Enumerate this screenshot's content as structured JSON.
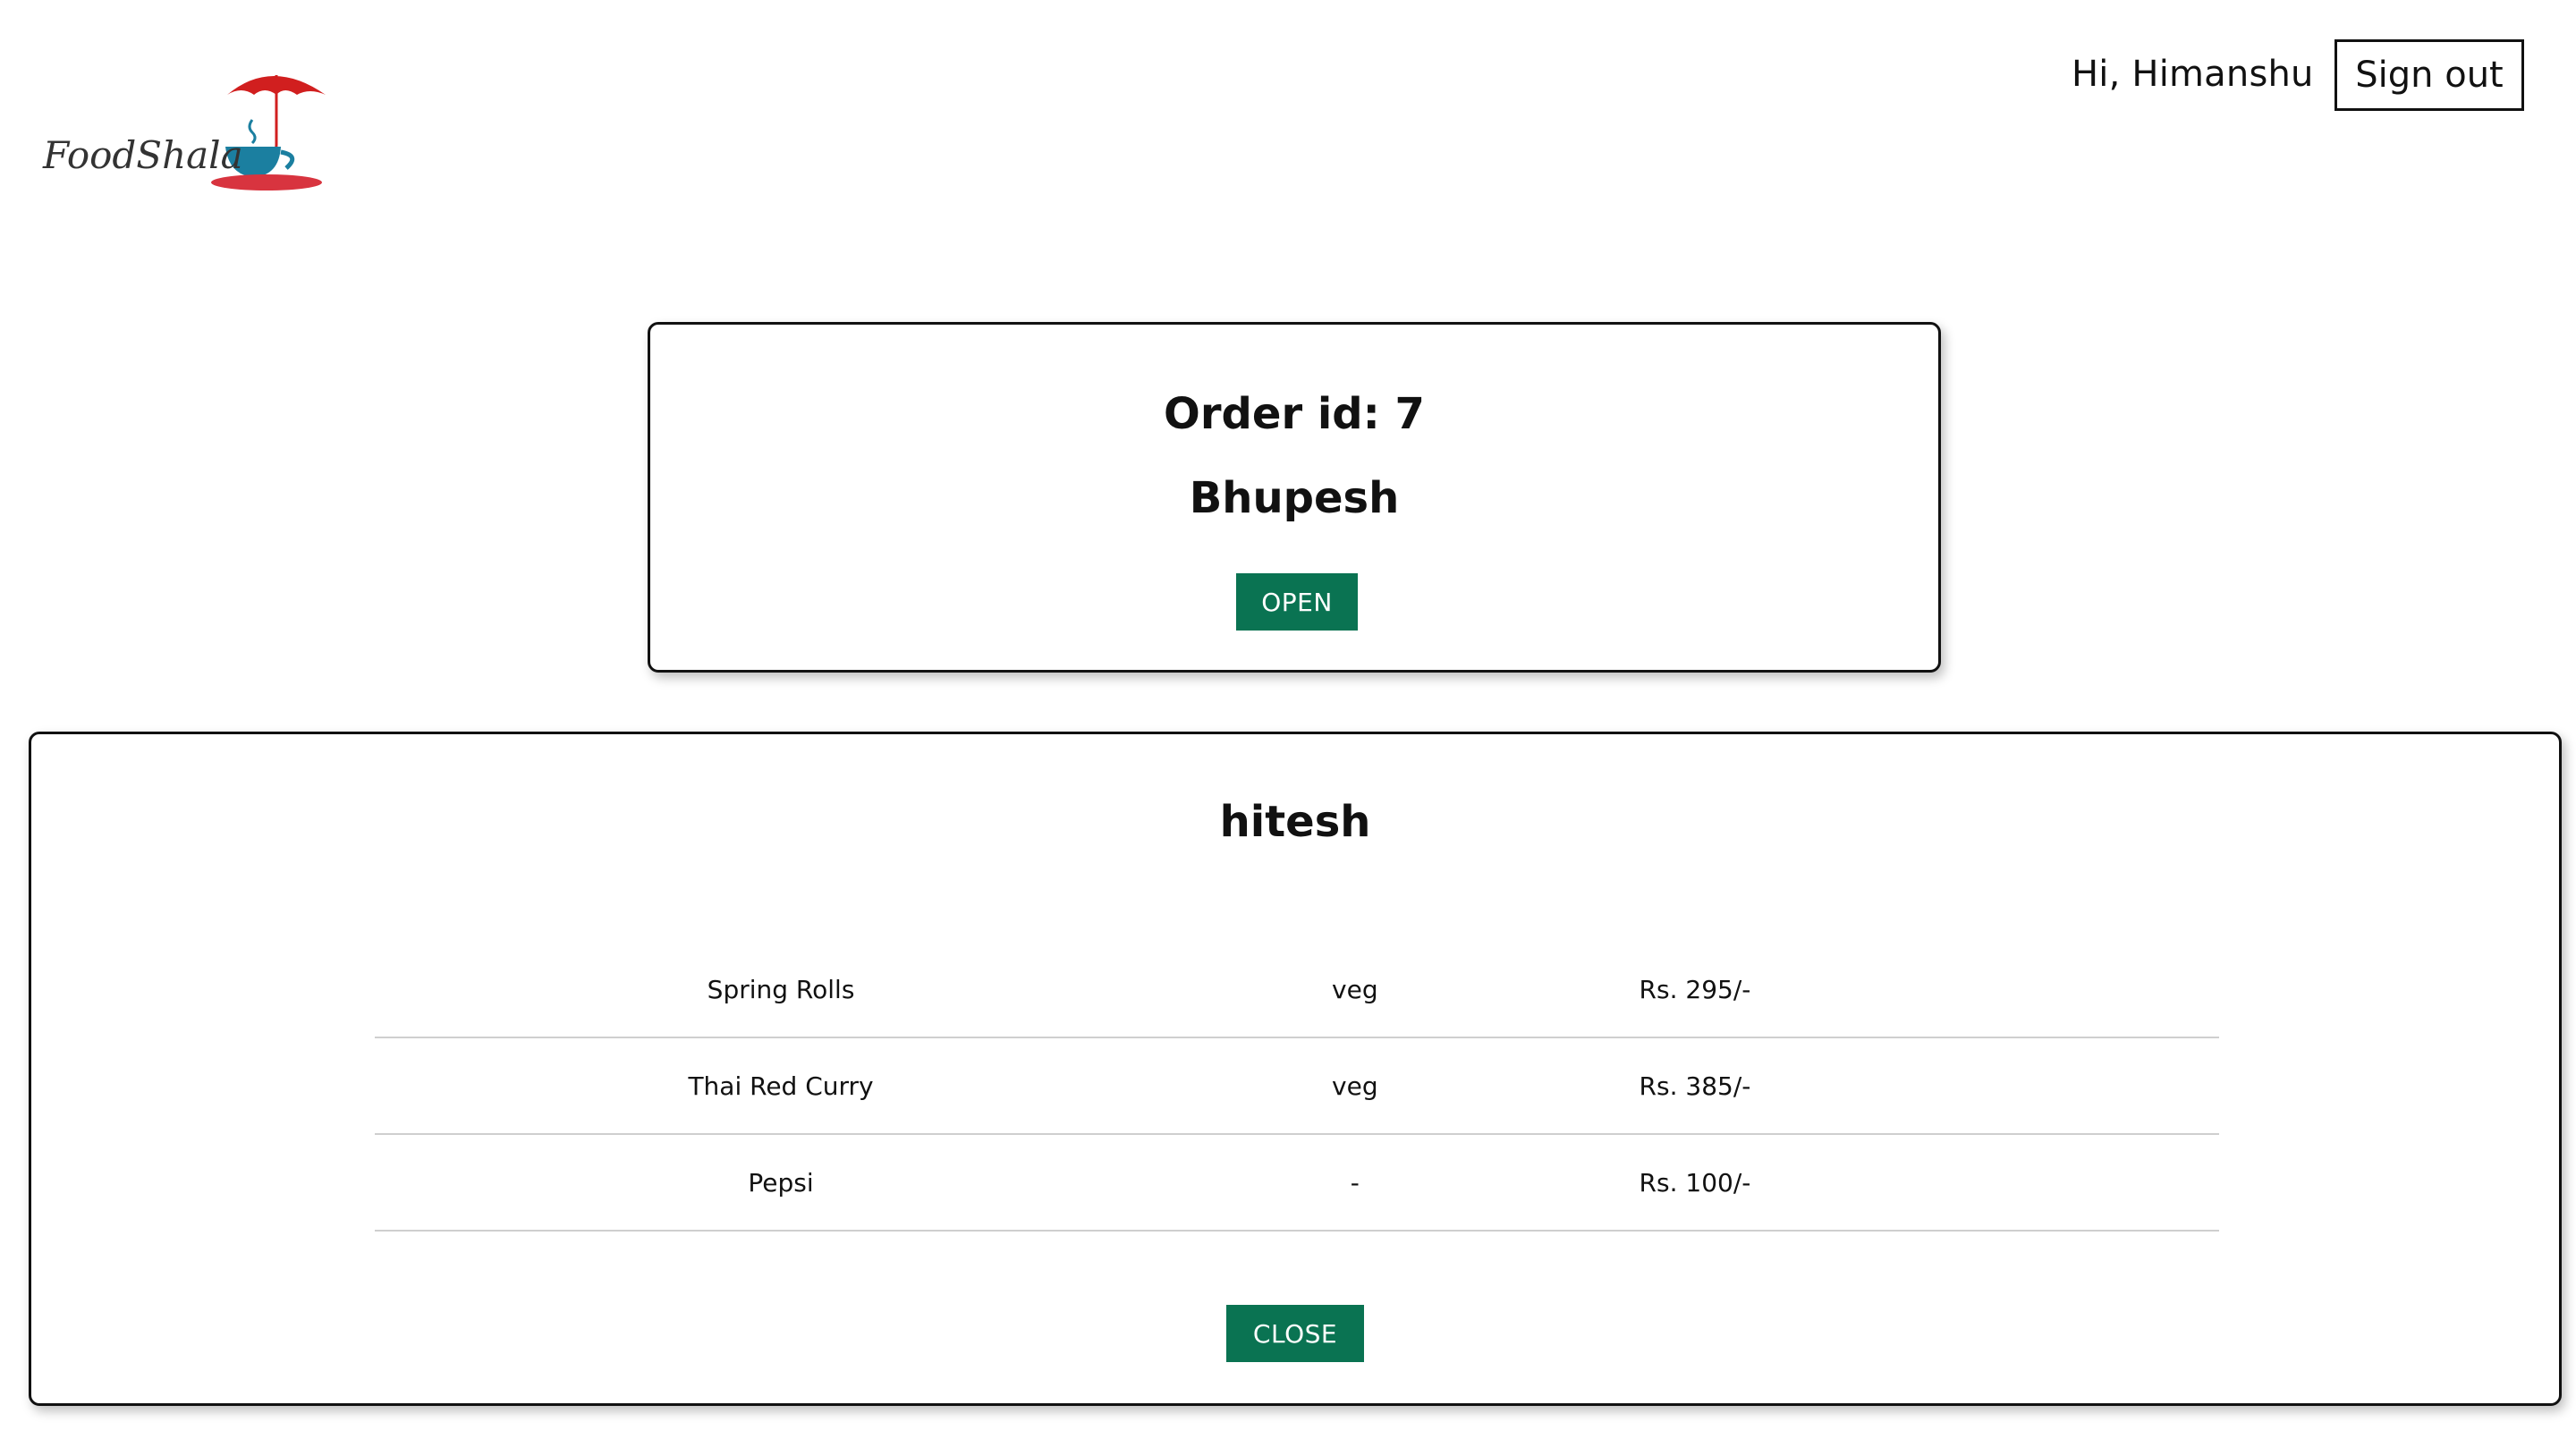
{
  "brand": {
    "logo_text": "FoodShala",
    "logo_colors": {
      "umbrella": "#d11f1f",
      "cup": "#1b7fa0",
      "saucer": "#d8343f",
      "text": "#333333"
    }
  },
  "header": {
    "greeting": "Hi, Himanshu",
    "signout_label": "Sign out"
  },
  "order_card": {
    "order_id_text": "Order id: 7",
    "customer_name": "Bhupesh",
    "open_label": "OPEN"
  },
  "detail_card": {
    "customer_name": "hitesh",
    "items": [
      {
        "name": "Spring Rolls",
        "type": "veg",
        "price": "Rs. 295/-"
      },
      {
        "name": "Thai Red Curry",
        "type": "veg",
        "price": "Rs. 385/-"
      },
      {
        "name": "Pepsi",
        "type": "-",
        "price": "Rs. 100/-"
      }
    ],
    "close_label": "CLOSE"
  },
  "colors": {
    "accent_button": "#0a7352",
    "border": "#111111",
    "row_divider": "#cfcfcf"
  }
}
